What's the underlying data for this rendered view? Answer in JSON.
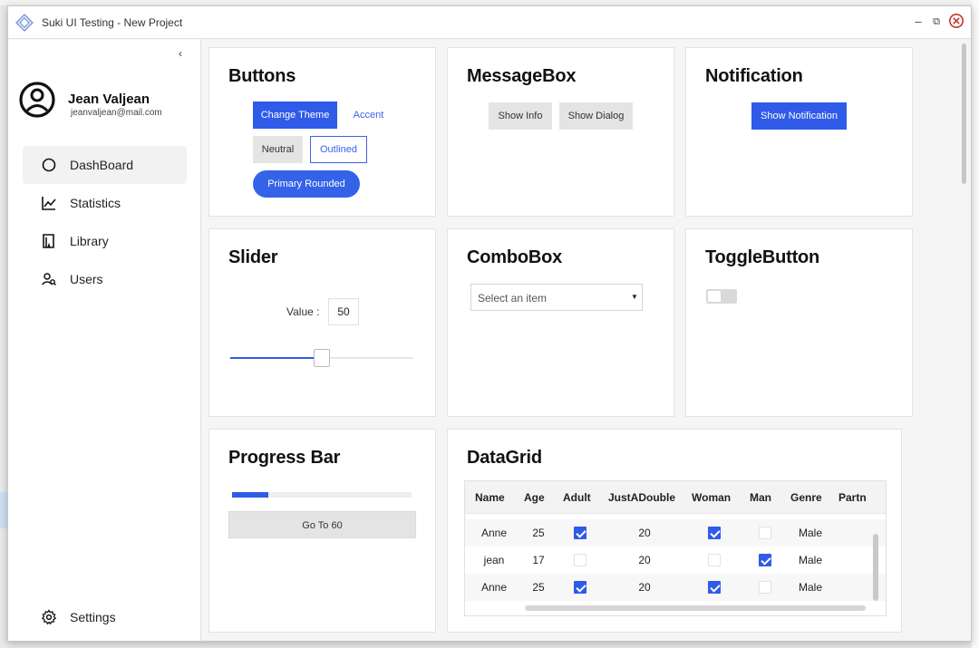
{
  "window": {
    "title": "Suki UI Testing - New Project",
    "controls": {
      "minimize": "–",
      "maximize": "⧉",
      "close": "⊗"
    }
  },
  "sidebar": {
    "collapse_glyph": "‹",
    "user": {
      "name": "Jean Valjean",
      "email": "jeanvaljean@mail.com"
    },
    "items": [
      {
        "label": "DashBoard",
        "icon": "circle-icon",
        "active": true
      },
      {
        "label": "Statistics",
        "icon": "chart-line-icon",
        "active": false
      },
      {
        "label": "Library",
        "icon": "book-icon",
        "active": false
      },
      {
        "label": "Users",
        "icon": "users-icon",
        "active": false
      }
    ],
    "settings": {
      "label": "Settings",
      "icon": "gear-icon"
    }
  },
  "cards": {
    "buttons": {
      "title": "Buttons",
      "change_theme": "Change Theme",
      "accent": "Accent",
      "neutral": "Neutral",
      "outlined": "Outlined",
      "primary_rounded": "Primary Rounded"
    },
    "messagebox": {
      "title": "MessageBox",
      "show_info": "Show Info",
      "show_dialog": "Show Dialog"
    },
    "notification": {
      "title": "Notification",
      "show_notification": "Show Notification"
    },
    "slider": {
      "title": "Slider",
      "value_label": "Value :",
      "value": "50",
      "min": 0,
      "max": 100,
      "level": 50
    },
    "combobox": {
      "title": "ComboBox",
      "placeholder": "Select an item"
    },
    "togglebutton": {
      "title": "ToggleButton",
      "checked": false
    },
    "progress": {
      "title": "Progress Bar",
      "percent": 20,
      "button": "Go To 60"
    },
    "datagrid": {
      "title": "DataGrid",
      "columns": [
        "Name",
        "Age",
        "Adult",
        "JustADouble",
        "Woman",
        "Man",
        "Genre",
        "Partn"
      ],
      "rows": [
        {
          "name": "Anne",
          "age": "25",
          "adult": true,
          "double": "20",
          "woman": true,
          "man": false,
          "genre": "Male"
        },
        {
          "name": "jean",
          "age": "17",
          "adult": false,
          "double": "20",
          "woman": false,
          "man": true,
          "genre": "Male"
        },
        {
          "name": "Anne",
          "age": "25",
          "adult": true,
          "double": "20",
          "woman": true,
          "man": false,
          "genre": "Male"
        }
      ]
    }
  },
  "colors": {
    "primary": "#2f5be8",
    "accent": "#3c62e6",
    "neutral": "#e4e4e4",
    "close": "#c0392b"
  }
}
